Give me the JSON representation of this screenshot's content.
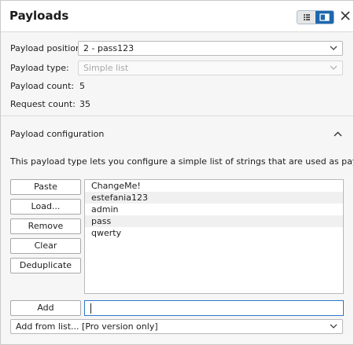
{
  "header": {
    "title": "Payloads",
    "icons": {
      "list_view": "list-view-icon",
      "panel_view": "panel-view-icon",
      "close": "close-icon"
    }
  },
  "payload_settings": {
    "position_label": "Payload position:",
    "position_value": "2 - pass123",
    "type_label": "Payload type:",
    "type_value": "Simple list",
    "count_label": "Payload count:",
    "count_value": "5",
    "request_label": "Request count:",
    "request_value": "35"
  },
  "config": {
    "title": "Payload configuration",
    "description": "This payload type lets you configure a simple list of strings that are used as payloads.",
    "buttons": {
      "paste": "Paste",
      "load": "Load...",
      "remove": "Remove",
      "clear": "Clear",
      "deduplicate": "Deduplicate",
      "add": "Add"
    },
    "items": [
      "ChangeMe!",
      "estefania123",
      "admin",
      "pass",
      "qwerty"
    ],
    "add_input_value": "",
    "add_from_list": "Add from list... [Pro version only]"
  },
  "colors": {
    "accent": "#1e67ad",
    "focus_border": "#2f78c8",
    "background": "#f6f6f6"
  }
}
